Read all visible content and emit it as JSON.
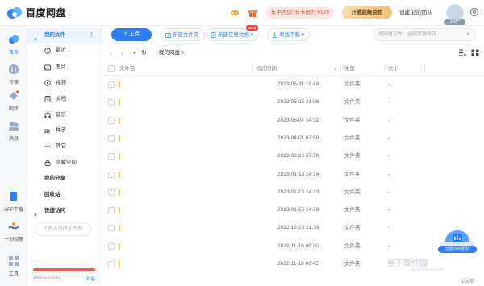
{
  "app": {
    "title": "百度网盘"
  },
  "header": {
    "promo": "年中大促! 年卡限时 ¥178",
    "vip_button": "开通超级会员",
    "team_link": "创建企业/团队",
    "user_name": "SIM**"
  },
  "rail": {
    "items": [
      {
        "label": "首页",
        "icon": "home-icon"
      },
      {
        "label": "传输",
        "icon": "transfer-icon"
      },
      {
        "label": "同步",
        "icon": "sync-icon"
      },
      {
        "label": "消息",
        "icon": "message-icon"
      },
      {
        "label": "APP下载",
        "icon": "phone-icon"
      },
      {
        "label": "一刻相册",
        "icon": "album-icon"
      },
      {
        "label": "工具",
        "icon": "tools-icon"
      }
    ]
  },
  "sidebar": {
    "my_files": "我的文件",
    "items": [
      {
        "label": "最近",
        "icon": "clock-icon"
      },
      {
        "label": "图片",
        "icon": "image-icon"
      },
      {
        "label": "视频",
        "icon": "video-icon"
      },
      {
        "label": "文档",
        "icon": "document-icon"
      },
      {
        "label": "音乐",
        "icon": "headphones-icon"
      },
      {
        "label": "种子",
        "icon": "bt-icon"
      },
      {
        "label": "其它",
        "icon": "more-icon"
      },
      {
        "label": "隐藏空间",
        "icon": "hidden-space-icon"
      }
    ],
    "my_share": "我的分享",
    "recycle": "回收站",
    "quick_access": "快捷访问",
    "add_quick_access": "+ 拖入常用文件夹",
    "storage_used": "1888G/2068G",
    "storage_fraction": 0.96,
    "expand_label": "扩容"
  },
  "toolbar": {
    "upload": "上传",
    "new_folder": "新建文件夹",
    "new_online_doc": "新建在线文档",
    "new_badge": "NEW",
    "offline_download": "离线下载",
    "search_placeholder": "搜网盘文件、全网资源资讯"
  },
  "breadcrumb": {
    "path": "我的网盘 >"
  },
  "table": {
    "columns": [
      "文件名",
      "修改时间",
      "类型",
      "大小"
    ],
    "rows": [
      {
        "name": "",
        "modified": "2023-05-31 19:48",
        "type": "文件夹",
        "size": "-"
      },
      {
        "name": "",
        "modified": "2023-05-25 21:06",
        "type": "文件夹",
        "size": "-"
      },
      {
        "name": "",
        "modified": "2023-05-07 14:22",
        "type": "文件夹",
        "size": "-"
      },
      {
        "name": "",
        "modified": "2023-04-01 07:50",
        "type": "文件夹",
        "size": "-"
      },
      {
        "name": "",
        "modified": "2023-03-26 07:59",
        "type": "文件夹",
        "size": "-"
      },
      {
        "name": "",
        "modified": "2023-01-15 14:14",
        "type": "文件夹",
        "size": "-"
      },
      {
        "name": "",
        "modified": "2023-01-15 14:13",
        "type": "文件夹",
        "size": "-"
      },
      {
        "name": "",
        "modified": "2023-01-05 14:28",
        "type": "文件夹",
        "size": "-"
      },
      {
        "name": "",
        "modified": "2022-12-10 21:39",
        "type": "文件夹",
        "size": "-"
      },
      {
        "name": "",
        "modified": "2022-11-19 09:20",
        "type": "文件夹",
        "size": "-"
      },
      {
        "name": "",
        "modified": "2022-11-19 06:45",
        "type": "文件夹",
        "size": "-"
      }
    ],
    "count": "108项"
  },
  "floating": {
    "label": "创建你的团队"
  },
  "watermark": {
    "text": "当下软件园",
    "sub": "www.downxia.com"
  },
  "colors": {
    "accent": "#2c7ef8",
    "promo": "#e2463b",
    "folder": "#f5c542"
  }
}
